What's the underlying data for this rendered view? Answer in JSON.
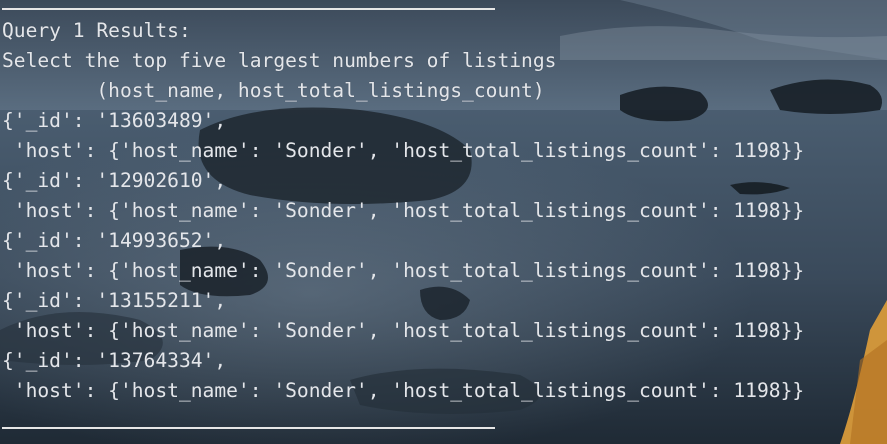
{
  "terminal": {
    "header": "Query 1 Results:",
    "description": "Select the top five largest numbers of listings",
    "fields": "        (host_name, host_total_listings_count)",
    "records": [
      {
        "id_line": "{'_id': '13603489',",
        "host_line": " 'host': {'host_name': 'Sonder', 'host_total_listings_count': 1198}}"
      },
      {
        "id_line": "{'_id': '12902610',",
        "host_line": " 'host': {'host_name': 'Sonder', 'host_total_listings_count': 1198}}"
      },
      {
        "id_line": "{'_id': '14993652',",
        "host_line": " 'host': {'host_name': 'Sonder', 'host_total_listings_count': 1198}}"
      },
      {
        "id_line": "{'_id': '13155211',",
        "host_line": " 'host': {'host_name': 'Sonder', 'host_total_listings_count': 1198}}"
      },
      {
        "id_line": "{'_id': '13764334',",
        "host_line": " 'host': {'host_name': 'Sonder', 'host_total_listings_count': 1198}}"
      }
    ]
  },
  "colors": {
    "text": "#e4e6ea",
    "background": "#2d3a47",
    "rule": "#e6e6e6"
  }
}
